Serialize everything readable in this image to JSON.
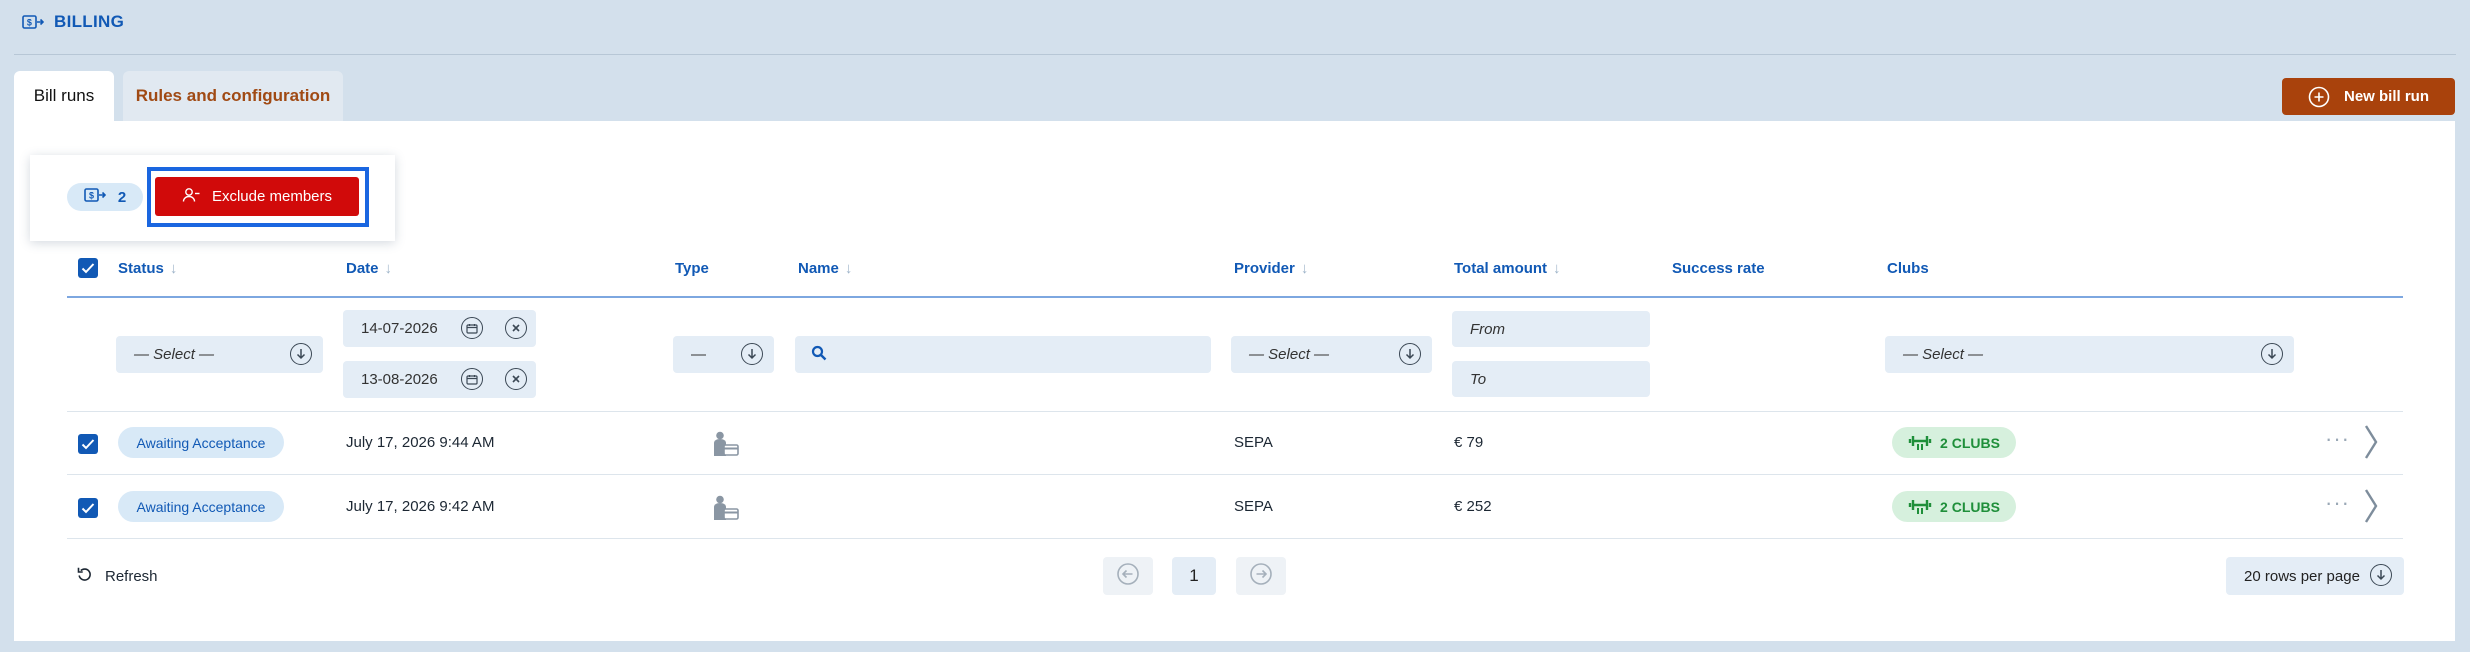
{
  "header": {
    "title": "BILLING",
    "icon": "billing-icon"
  },
  "tabs": [
    {
      "label": "Bill runs",
      "active": true
    },
    {
      "label": "Rules and configuration",
      "active": false
    }
  ],
  "actions": {
    "new_bill_run": "New bill run"
  },
  "selection": {
    "count": "2",
    "exclude_label": "Exclude members"
  },
  "columns": {
    "status": "Status",
    "date": "Date",
    "type": "Type",
    "name": "Name",
    "provider": "Provider",
    "total_amount": "Total amount",
    "success_rate": "Success rate",
    "clubs": "Clubs"
  },
  "filters": {
    "status_placeholder": "— Select —",
    "date_from": "14-07-2026",
    "date_to": "13-08-2026",
    "type_placeholder": "—",
    "provider_placeholder": "— Select —",
    "amount_from": "From",
    "amount_to": "To",
    "clubs_placeholder": "— Select —"
  },
  "rows": [
    {
      "status": "Awaiting Acceptance",
      "date": "July 17, 2026 9:44 AM",
      "type_icon": "member-card-icon",
      "name": "",
      "provider": "SEPA",
      "total": "€ 79",
      "success_rate": "",
      "clubs": "2 CLUBS",
      "checked": true
    },
    {
      "status": "Awaiting Acceptance",
      "date": "July 17, 2026 9:42 AM",
      "type_icon": "member-card-icon",
      "name": "",
      "provider": "SEPA",
      "total": "€ 252",
      "success_rate": "",
      "clubs": "2 CLUBS",
      "checked": true
    }
  ],
  "footer": {
    "refresh": "Refresh",
    "page": "1",
    "rows_per_page": "20 rows per page"
  },
  "colors": {
    "background": "#d3e0ec",
    "primary_blue": "#1159b5",
    "brand_orange": "#a9420c",
    "danger_red": "#d10a0a",
    "focus_blue": "#1a66e0",
    "status_pill_bg": "#d8e9f7",
    "clubs_pill_bg": "#d6f0dd",
    "clubs_green": "#1f8f3a"
  }
}
